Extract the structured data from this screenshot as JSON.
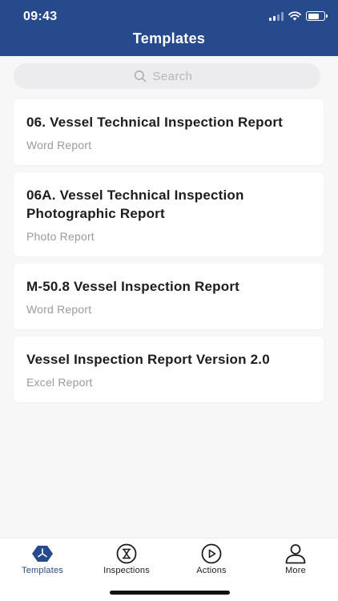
{
  "status_bar": {
    "time": "09:43"
  },
  "header": {
    "title": "Templates"
  },
  "search": {
    "placeholder": "Search"
  },
  "templates": [
    {
      "title": "06. Vessel Technical Inspection Report",
      "type": "Word Report"
    },
    {
      "title": "06A. Vessel Technical Inspection Photographic Report",
      "type": "Photo Report"
    },
    {
      "title": "M-50.8 Vessel Inspection Report",
      "type": "Word Report"
    },
    {
      "title": "Vessel Inspection Report Version 2.0",
      "type": "Excel Report"
    }
  ],
  "tabbar": {
    "tabs": [
      {
        "label": "Templates",
        "icon": "templates-icon",
        "active": true
      },
      {
        "label": "Inspections",
        "icon": "hourglass-icon",
        "active": false
      },
      {
        "label": "Actions",
        "icon": "play-icon",
        "active": false
      },
      {
        "label": "More",
        "icon": "person-icon",
        "active": false
      }
    ]
  },
  "colors": {
    "brand": "#264a8c",
    "background": "#f7f7f8",
    "card": "#ffffff",
    "subtext": "#9a9a9e"
  }
}
